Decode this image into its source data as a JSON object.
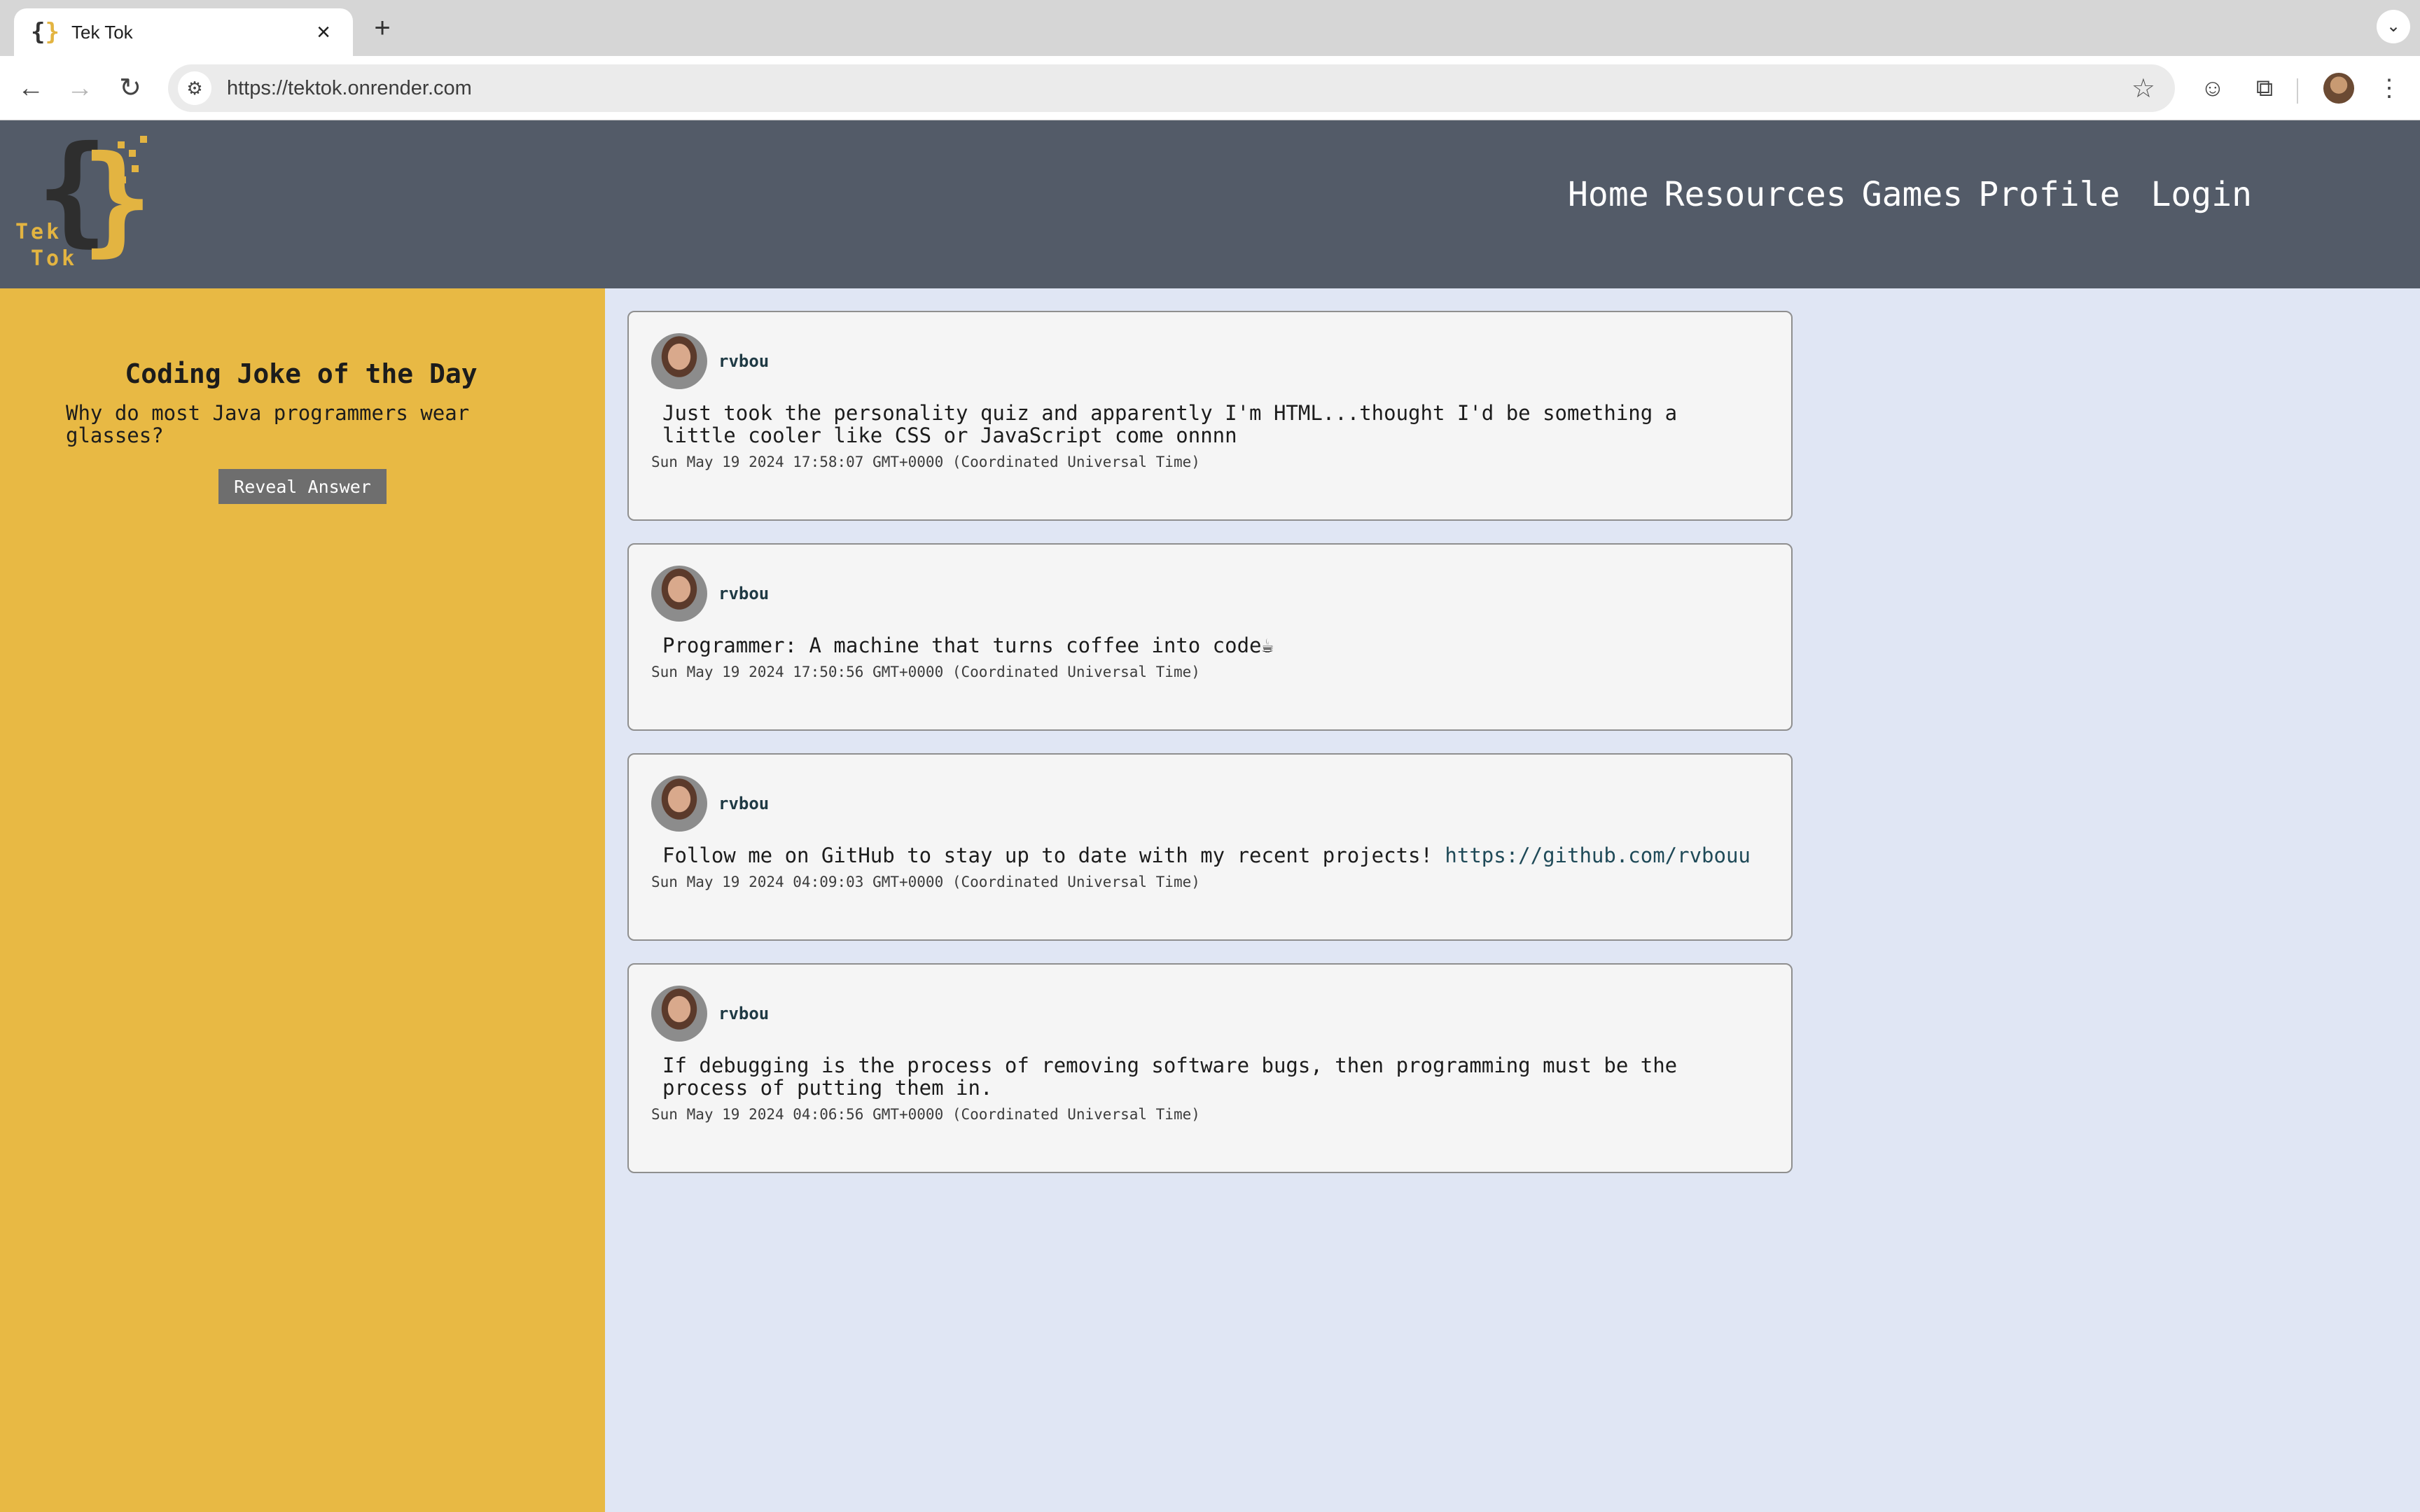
{
  "browser": {
    "tab_title": "Tek Tok",
    "url": "https://tektok.onrender.com"
  },
  "site": {
    "logo_text_1": "Tek",
    "logo_text_2": "Tok",
    "nav": [
      "Home",
      "Resources",
      "Games",
      "Profile",
      "Login"
    ]
  },
  "sidebar": {
    "title": "Coding Joke of the Day",
    "question": "Why do most Java programmers wear glasses?",
    "reveal_label": "Reveal Answer"
  },
  "posts": [
    {
      "username": "rvbou",
      "text": "Just took the personality quiz and apparently I'm HTML...thought I'd be something a little cooler like CSS or JavaScript come onnnn",
      "timestamp": "Sun May 19 2024 17:58:07 GMT+0000 (Coordinated Universal Time)"
    },
    {
      "username": "rvbou",
      "text": "Programmer: A machine that turns coffee into code☕",
      "timestamp": "Sun May 19 2024 17:50:56 GMT+0000 (Coordinated Universal Time)"
    },
    {
      "username": "rvbou",
      "text": "Follow me on GitHub to stay up to date with my recent projects! ",
      "link": "https://github.com/rvbouu",
      "timestamp": "Sun May 19 2024 04:09:03 GMT+0000 (Coordinated Universal Time)"
    },
    {
      "username": "rvbou",
      "text": "If debugging is the process of removing software bugs, then programming must be the process of putting them in.",
      "timestamp": "Sun May 19 2024 04:06:56 GMT+0000 (Coordinated Universal Time)"
    }
  ],
  "colors": {
    "header": "#535b68",
    "sidebar": "#e8b944",
    "feed_bg": "#e0e6f4",
    "accent": "#e3b441"
  }
}
